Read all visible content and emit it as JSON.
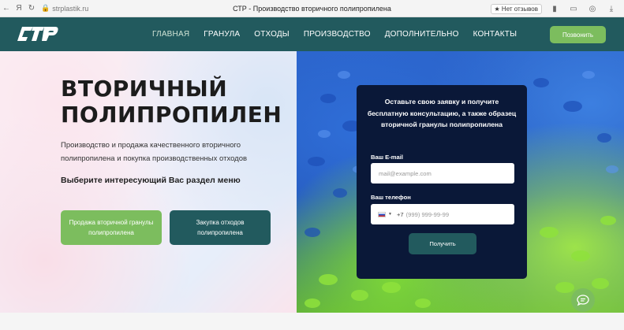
{
  "browser": {
    "url": "strplastik.ru",
    "tab_title": "СТР - Производство вторичного полипропилена",
    "reviews": "★ Нет отзывов"
  },
  "header": {
    "logo_text": "СТР",
    "nav": [
      {
        "label": "ГЛАВНАЯ"
      },
      {
        "label": "ГРАНУЛА"
      },
      {
        "label": "ОТХОДЫ"
      },
      {
        "label": "ПРОИЗВОДСТВО"
      },
      {
        "label": "ДОПОЛНИТЕЛЬНО"
      },
      {
        "label": "КОНТАКТЫ"
      }
    ],
    "callback_label": "Позвонить"
  },
  "hero": {
    "title_line1": "ВТОРИЧНЫЙ",
    "title_line2": "ПОЛИПРОПИЛЕН",
    "description": "Производство и продажа качественного вторичного полипропилена и покупка производственных отходов",
    "prompt": "Выберите интересующий Вас раздел меню",
    "btn_sell": "Продажа вторичной гранулы полипропилена",
    "btn_buy": "Закупка отходов полипропилена"
  },
  "form": {
    "heading": "Оставьте свою заявку и получите бесплатную консультацию, а также образец вторичной гранулы полипропилена",
    "email_label": "Ваш E-mail",
    "email_placeholder": "mail@example.com",
    "phone_label": "Ваш телефон",
    "phone_code": "+7",
    "phone_placeholder": "(999) 999-99-99",
    "submit_label": "Получить"
  },
  "colors": {
    "header_bg": "#225a5e",
    "accent_green": "#7cbd5e",
    "form_bg": "#0a1838"
  }
}
